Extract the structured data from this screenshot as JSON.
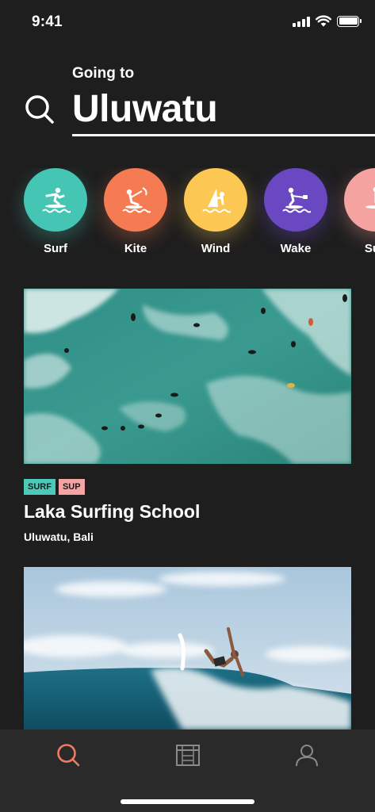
{
  "status": {
    "time": "9:41"
  },
  "search": {
    "label": "Going to",
    "destination": "Uluwatu"
  },
  "categories": [
    {
      "label": "Surf",
      "color": "#45c6b5",
      "icon": "surfer-icon"
    },
    {
      "label": "Kite",
      "color": "#f57c52",
      "icon": "kitesurfer-icon"
    },
    {
      "label": "Wind",
      "color": "#fcc853",
      "icon": "windsurfer-icon"
    },
    {
      "label": "Wake",
      "color": "#6a48c2",
      "icon": "wakeboarder-icon"
    },
    {
      "label": "Sup",
      "color": "#f5a3a0",
      "icon": "paddleboarder-icon"
    }
  ],
  "listings": [
    {
      "title": "Laka Surfing School",
      "location": "Uluwatu, Bali",
      "tags": [
        {
          "label": "SURF",
          "color": "#4cc9b9"
        },
        {
          "label": "SUP",
          "color": "#f4a4a4"
        }
      ],
      "image": "aerial-ocean-surfers"
    },
    {
      "title": "",
      "location": "",
      "tags": [],
      "image": "surfer-riding-wave"
    }
  ],
  "tabbar": [
    {
      "icon": "search-icon",
      "active": true,
      "color": "#f37a60"
    },
    {
      "icon": "bookings-icon",
      "active": false,
      "color": "#8a8a8a"
    },
    {
      "icon": "profile-icon",
      "active": false,
      "color": "#8a8a8a"
    }
  ]
}
